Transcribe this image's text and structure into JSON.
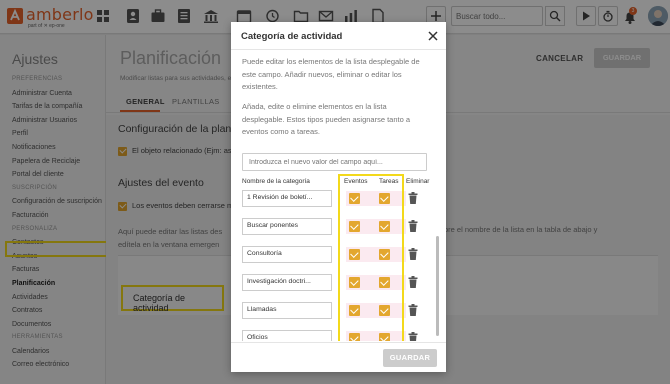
{
  "app": {
    "logo_text": "amberlo",
    "logo_sub": "part of ✕ ep-one",
    "search_placeholder": "Buscar todo...",
    "notification_count": "3"
  },
  "sidebar": {
    "title": "Ajustes",
    "items": [
      {
        "label": "PREFERENCIAS",
        "type": "section"
      },
      {
        "label": "Administrar Cuenta",
        "type": "item"
      },
      {
        "label": "Tarifas de la compañía",
        "type": "item"
      },
      {
        "label": "Administrar Usuarios",
        "type": "item"
      },
      {
        "label": "Perfil",
        "type": "item"
      },
      {
        "label": "Notificaciones",
        "type": "item"
      },
      {
        "label": "Papelera de Reciclaje",
        "type": "item"
      },
      {
        "label": "Portal del cliente",
        "type": "item"
      },
      {
        "label": "SUSCRIPCIÓN",
        "type": "section"
      },
      {
        "label": "Configuración de suscripción",
        "type": "item"
      },
      {
        "label": "Facturación",
        "type": "item"
      },
      {
        "label": "PERSONALIZA",
        "type": "section"
      },
      {
        "label": "Contactos",
        "type": "item"
      },
      {
        "label": "Asuntos",
        "type": "item"
      },
      {
        "label": "Facturas",
        "type": "item"
      },
      {
        "label": "Planificación",
        "type": "active"
      },
      {
        "label": "Actividades",
        "type": "item"
      },
      {
        "label": "Contratos",
        "type": "item"
      },
      {
        "label": "Documentos",
        "type": "item"
      },
      {
        "label": "HERRAMIENTAS",
        "type": "section"
      },
      {
        "label": "Calendarios",
        "type": "item"
      },
      {
        "label": "Correo electrónico",
        "type": "item"
      }
    ]
  },
  "main": {
    "title": "Planificación",
    "subtitle": "Modificar listas para sus actividades, ev",
    "tab_general": "GENERAL",
    "tab_plantillas": "PLANTILLAS",
    "cancel_label": "CANCELAR",
    "save_label": "GUARDAR",
    "section1_title": "Configuración de la planific",
    "section1_check": "El objeto relacionado (Ejm: as",
    "section2_title": "Ajustes del evento",
    "section2_check": "Los eventos deben cerrarse m",
    "info_line1": "Aquí puede editar las listas des",
    "info_line2": "edítela en la ventana emergen",
    "info_right": "bre el nombre de la lista en la tabla de abajo y",
    "category_label": "Categoría de actividad"
  },
  "modal": {
    "title": "Categoría de actividad",
    "para1": "Puede editar los elementos de la lista desplegable de este campo. Añadir nuevos, eliminar o editar los existentes.",
    "para2": "Añada, edite o elimine elementos en la lista desplegable. Estos tipos pueden asignarse tanto a eventos como a tareas.",
    "new_placeholder": "Introduzca el nuevo valor del campo aquí...",
    "col_name": "Nombre de la categoría",
    "col_events": "Eventos",
    "col_tasks": "Tareas",
    "col_delete": "Eliminar",
    "rows": [
      {
        "name": "1 Revisión de boletí...",
        "events": true,
        "tasks": true
      },
      {
        "name": "Buscar ponentes",
        "events": true,
        "tasks": true
      },
      {
        "name": "Consultoría",
        "events": true,
        "tasks": true
      },
      {
        "name": "Investigación doctri...",
        "events": true,
        "tasks": true
      },
      {
        "name": "Llamadas",
        "events": true,
        "tasks": true
      },
      {
        "name": "Oficios",
        "events": true,
        "tasks": true
      }
    ],
    "save_label": "GUARDAR"
  }
}
